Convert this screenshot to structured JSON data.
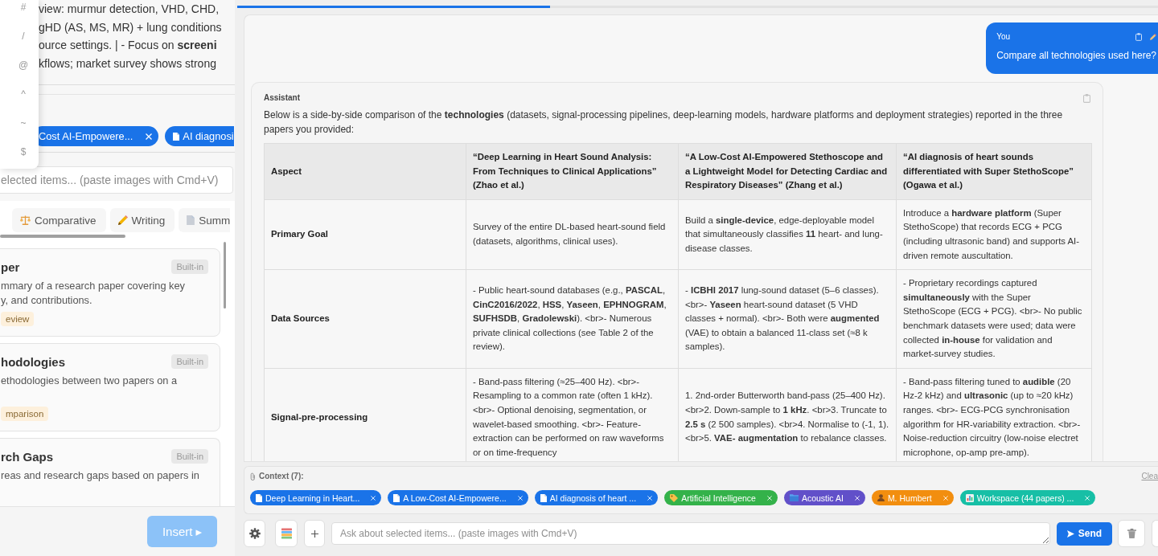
{
  "left_panel": {
    "shortcut_menu": [
      {
        "symbol": "#"
      },
      {
        "symbol": "/"
      },
      {
        "symbol": "@"
      },
      {
        "symbol": "^"
      },
      {
        "symbol": "~"
      },
      {
        "symbol": "$"
      }
    ],
    "preview_lines": [
      "view: murmur detection, VHD, CHD,",
      "gHD (AS, MS, MR) + lung conditions",
      "ource settings. | - Focus on **screeni**",
      "kflows; market survey shows strong"
    ],
    "selected_chips": [
      {
        "label": "Cost AI-Empowere...",
        "kind": "plain"
      },
      {
        "label": "AI diagnosi",
        "kind": "paper"
      }
    ],
    "input": {
      "placeholder": "elected items... (paste images with Cmd+V)"
    },
    "template_tabs": [
      {
        "label": "Comparative",
        "kind": "comparative",
        "selected": false
      },
      {
        "label": "Writing",
        "kind": "writing",
        "selected": false
      },
      {
        "label": "Summ",
        "kind": "summary",
        "selected": false
      }
    ],
    "templates": [
      {
        "title": "per",
        "badge": "Built-in",
        "description_lines": [
          "mmary of a research paper covering key",
          "y, and contributions."
        ],
        "tag": "eview"
      },
      {
        "title": "hodologies",
        "badge": "Built-in",
        "description_lines": [
          "ethodologies between two papers on a"
        ],
        "tag": "mparison"
      },
      {
        "title": "rch Gaps",
        "badge": "Built-in",
        "description_lines": [
          "reas and research gaps based on papers in"
        ]
      }
    ],
    "insert_button": {
      "label": "Insert ▸",
      "disabled": true
    }
  },
  "main": {
    "progress": {
      "level": 0.34
    },
    "messages": [
      {
        "kind": "user",
        "author": "You",
        "text": "Compare all technologies used here?"
      },
      {
        "kind": "assistant",
        "author": "Assistant",
        "text": "Below is a side-by-side comparison of the **technologies** (datasets, signal-processing pipelines, deep-learning models, hardware platforms and deployment strategies) reported in the three papers you provided:",
        "table": {
          "columns": [
            "Aspect",
            "“Deep Learning in Heart Sound Analysis: From Techniques to Clinical Applications” (Zhao et al.)",
            "“A Low-Cost AI-Empowered Stethoscope and a Lightweight Model for Detecting Cardiac and Respiratory Diseases” (Zhang et al.)",
            "“AI diagnosis of heart sounds differentiated with Super StethoScope” (Ogawa et al.)"
          ],
          "rows": [
            [
              "Primary Goal",
              "Survey of the entire DL-based heart-sound field (datasets, algorithms, clinical uses).",
              "Build a **single-device**, edge-deployable model that simultaneously classifies **11** heart- and lung-disease classes.",
              "Introduce a **hardware platform** (Super StethoScope) that records ECG + PCG (including ultrasonic band) and supports AI-driven remote auscultation."
            ],
            [
              "Data Sources",
              "- Public heart-sound databases (e.g., **PASCAL**, **CinC2016/2022**, **HSS**, **Yaseen**, **EPHNOGRAM**, **SUFHSDB**, **Gradolewski**). <br>- Numerous private clinical collections (see Table 2 of the review).",
              "- **ICBHI 2017** lung-sound dataset (5–6 classes). <br>- **Yaseen** heart-sound dataset (5 VHD classes + normal). <br>- Both were **augmented** (VAE) to obtain a balanced 11-class set (≈8 k samples).",
              "- Proprietary recordings captured **simultaneously** with the Super StethoScope (ECG + PCG). <br>- No public benchmark datasets were used; data were collected **in-house** for validation and market-survey studies."
            ],
            [
              "Signal-pre-processing",
              "- Band-pass filtering (≈25–400 Hz). <br>- Resampling to a common rate (often 1 kHz). <br>- Optional denoising, segmentation, or wavelet-based smoothing. <br>- Feature-extraction can be performed on raw waveforms or on time-frequency",
              "1. 2nd-order Butterworth band-pass (25–400 Hz). <br>2. Down-sample to **1 kHz**. <br>3. Truncate to **2.5 s** (2 500 samples). <br>4. Normalise to (-1, 1). <br>5. **VAE- augmentation** to rebalance classes.",
              "- Band-pass filtering tuned to **audible** (20 Hz-2 kHz) and **ultrasonic** (up to ≈20 kHz) ranges. <br>- ECG-PCG synchronisation algorithm for HR-variability extraction. <br>- Noise-reduction circuitry (low-noise electret microphone, op-amp pre-amp)."
            ]
          ]
        }
      }
    ],
    "context": {
      "title": "Context (7):",
      "clear_link": "Clea",
      "chips": [
        {
          "label": "Deep Learning in Heart...",
          "kind": "paper",
          "color": "#1a73e8"
        },
        {
          "label": "A Low-Cost AI-Empowere...",
          "kind": "paper",
          "color": "#1a73e8"
        },
        {
          "label": "AI diagnosis of heart ...",
          "kind": "paper",
          "color": "#1a73e8"
        },
        {
          "label": "Artificial Intelligence",
          "kind": "tag",
          "color": "#34b24a"
        },
        {
          "label": "Acoustic AI",
          "kind": "collection",
          "color": "#6150c9"
        },
        {
          "label": "M. Humbert",
          "kind": "author",
          "color": "#f28e0f"
        },
        {
          "label": "Workspace (44 papers) ...",
          "kind": "workspace",
          "color": "#17bfa6"
        }
      ]
    },
    "composer": {
      "placeholder": "Ask about selected items... (paste images with Cmd+V)",
      "send_button": "Send"
    }
  }
}
